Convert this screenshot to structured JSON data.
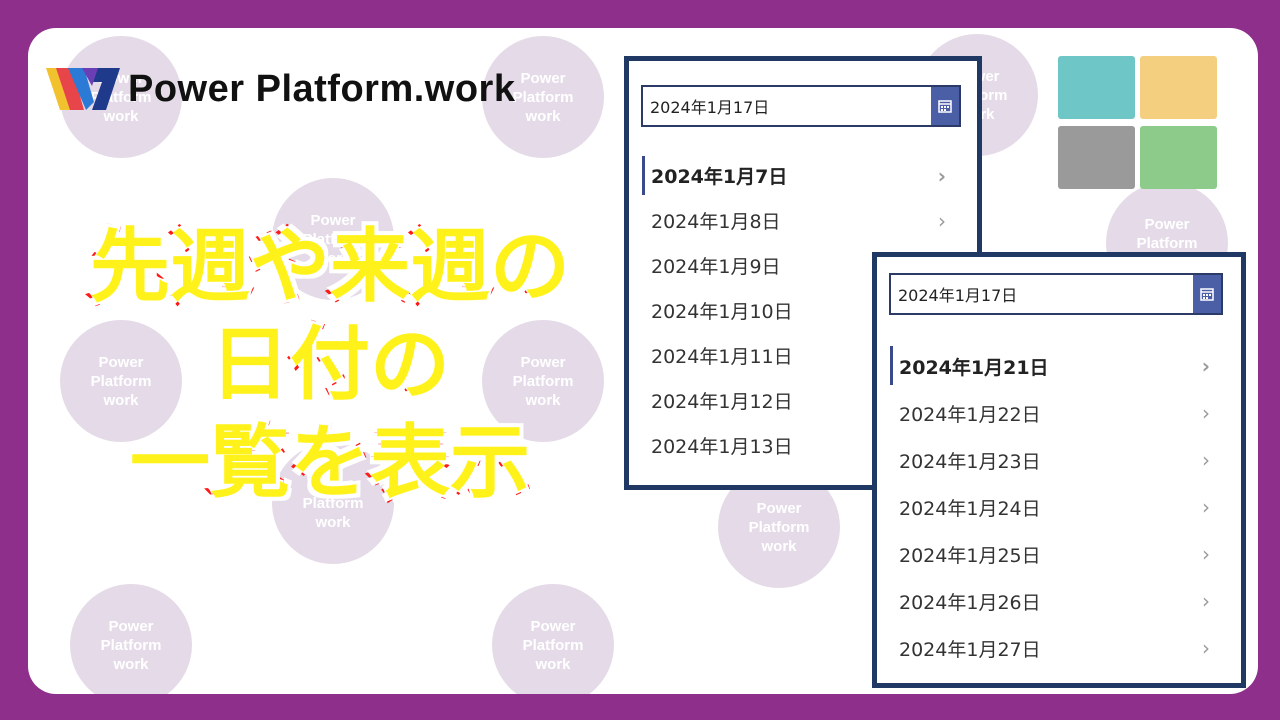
{
  "logo": {
    "text": "Power Platform.work"
  },
  "watermark": {
    "text": "Power\nPlatform\nwork"
  },
  "headline": {
    "line1": "先週や来週の",
    "line2": "日付の",
    "line3": "一覧を表示"
  },
  "tiles": {
    "colors": [
      "#6ec6c6",
      "#f4cf80",
      "#9a9a9a",
      "#8dcb8a"
    ]
  },
  "colors": {
    "frame": "#8e2f8c",
    "panel_border": "#1f3864",
    "datepicker_button": "#4a5fa6",
    "headline_fill": "#fff21b",
    "headline_stroke": "#ff1a1a"
  },
  "panel_last_week": {
    "datepicker": {
      "value": "2024年1月17日",
      "icon": "calendar-icon"
    },
    "items": [
      {
        "label": "2024年1月7日",
        "selected": true
      },
      {
        "label": "2024年1月8日"
      },
      {
        "label": "2024年1月9日"
      },
      {
        "label": "2024年1月10日"
      },
      {
        "label": "2024年1月11日"
      },
      {
        "label": "2024年1月12日"
      },
      {
        "label": "2024年1月13日"
      }
    ]
  },
  "panel_next_week": {
    "datepicker": {
      "value": "2024年1月17日",
      "icon": "calendar-icon"
    },
    "items": [
      {
        "label": "2024年1月21日",
        "selected": true
      },
      {
        "label": "2024年1月22日"
      },
      {
        "label": "2024年1月23日"
      },
      {
        "label": "2024年1月24日"
      },
      {
        "label": "2024年1月25日"
      },
      {
        "label": "2024年1月26日"
      },
      {
        "label": "2024年1月27日"
      }
    ]
  }
}
